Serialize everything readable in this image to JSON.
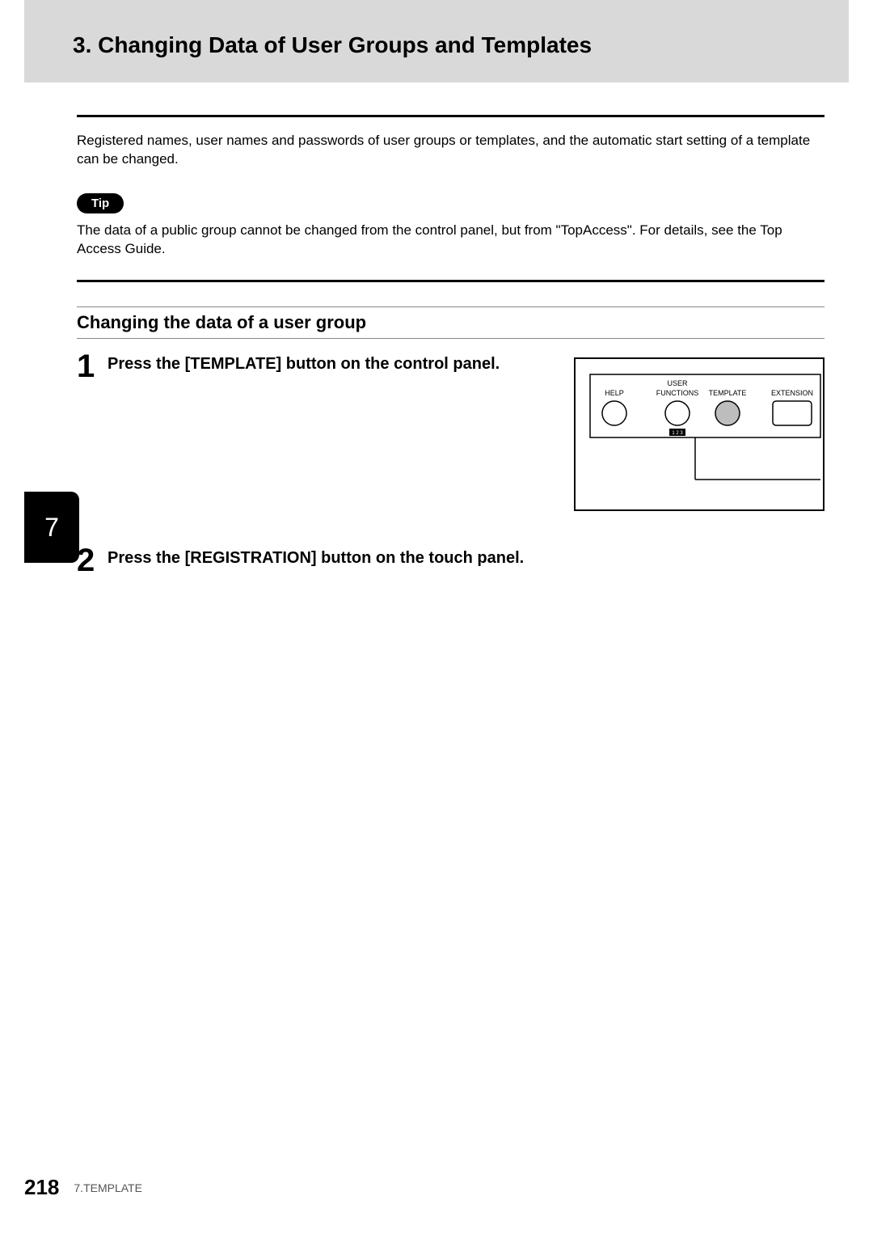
{
  "header": {
    "title": "3. Changing Data of User Groups and Templates"
  },
  "intro": "Registered names, user names and passwords of user groups or templates, and the automatic start setting of a template can be changed.",
  "tip": {
    "label": "Tip",
    "text": "The data of a public group cannot be changed from the control panel, but from \"TopAccess\". For details, see the Top Access Guide."
  },
  "section_heading": "Changing the data of a user group",
  "steps": [
    {
      "num": "1",
      "text": "Press the [TEMPLATE] button on the control panel."
    },
    {
      "num": "2",
      "text": "Press the [REGISTRATION] button on the touch panel."
    }
  ],
  "panel": {
    "help": "HELP",
    "user_functions_line1": "USER",
    "user_functions_line2": "FUNCTIONS",
    "template": "TEMPLATE",
    "extension": "EXTENSION",
    "small_label": "1 2 3"
  },
  "chapter_tab": "7",
  "footer": {
    "page": "218",
    "chapter": "7.TEMPLATE"
  }
}
